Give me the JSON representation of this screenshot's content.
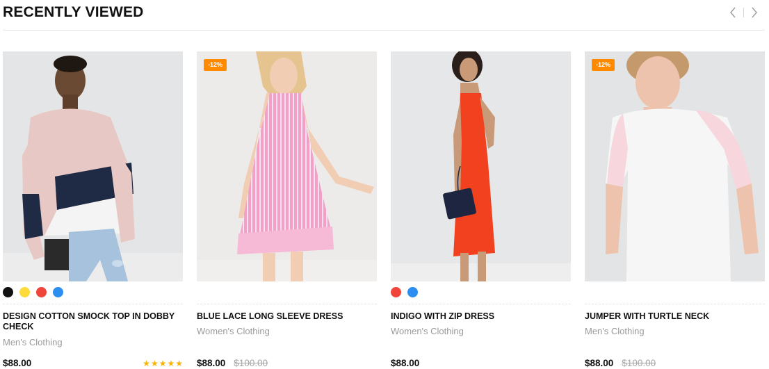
{
  "section": {
    "title": "RECENTLY VIEWED",
    "nav": {
      "prev_icon": "chevron-left-icon",
      "next_icon": "chevron-right-icon"
    }
  },
  "products": [
    {
      "name": "DESIGN COTTON SMOCK TOP IN DOBBY CHECK",
      "category": "Men's Clothing",
      "price": "$88.00",
      "old_price": "",
      "badge": "",
      "rating": 5,
      "swatches": [
        "#111111",
        "#fddb3a",
        "#f0453a",
        "#2c8ef0"
      ]
    },
    {
      "name": "BLUE LACE LONG SLEEVE DRESS",
      "category": "Women's Clothing",
      "price": "$88.00",
      "old_price": "$100.00",
      "badge": "-12%",
      "rating": 0,
      "swatches": []
    },
    {
      "name": "INDIGO WITH ZIP DRESS",
      "category": "Women's Clothing",
      "price": "$88.00",
      "old_price": "",
      "badge": "",
      "rating": 0,
      "swatches": [
        "#f0453a",
        "#2c8ef0"
      ]
    },
    {
      "name": "JUMPER WITH TURTLE NECK",
      "category": "Men's Clothing",
      "price": "$88.00",
      "old_price": "$100.00",
      "badge": "-12%",
      "rating": 0,
      "swatches": []
    }
  ],
  "colors": {
    "badge": "#ff8a00",
    "star": "#f5b400"
  }
}
